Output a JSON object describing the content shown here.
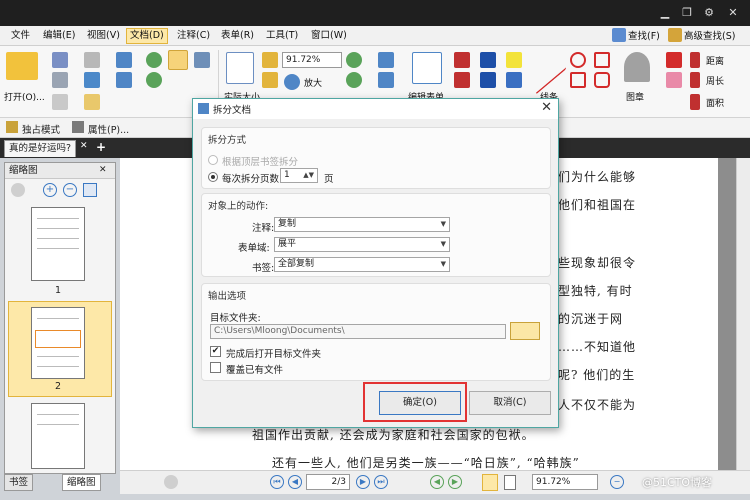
{
  "menu": [
    "文件",
    "编辑(E)",
    "视图(V)",
    "文档(D)",
    "注释(C)",
    "表单(R)",
    "工具(T)",
    "窗口(W)"
  ],
  "menu_active_index": 3,
  "menu_right": {
    "find": "查找(F)",
    "advanced_find": "高级查找(S)"
  },
  "ribbon": {
    "open_label": "打开(O)...",
    "zoom_value": "91.72%",
    "zoom_in_label": "放大",
    "actual_size_label": "实际大小",
    "edit_form_label": "编辑表单",
    "line_label": "线条",
    "stamp_label": "图章",
    "distance_label": "距离",
    "perimeter_label": "周长",
    "area_label": "面积"
  },
  "modebar": {
    "exclusive_mode": "独占模式",
    "properties": "属性(P)..."
  },
  "doc_tab": "真的是好运吗?",
  "left_panel": {
    "title": "缩略图",
    "pages": [
      "1",
      "2"
    ],
    "selected": "2"
  },
  "bottom_tabs": [
    "书签",
    "缩略图"
  ],
  "document_lines": [
    "们为什么能够",
    "他们和祖国在",
    "些现象却很令",
    "型独特, 有时",
    "的沉迷于网",
    "……不知道他",
    "呢? 他们的生",
    "人不仅不能为",
    "祖国作出贡献, 还会成为家庭和社会国家的包袱。",
    "还有一些人, 他们是另类一族——“哈日族”, “哈韩族”"
  ],
  "status": {
    "page_value": "2",
    "page_total": "/3",
    "zoom": "91.72%"
  },
  "dialog": {
    "title": "拆分文档",
    "split_method": {
      "title": "拆分方式",
      "by_bookmark": "根据顶层书签拆分",
      "by_pages": "每次拆分页数",
      "pages_value": "1",
      "pages_unit": "页"
    },
    "actions": {
      "title": "对象上的动作:",
      "annotations_label": "注释:",
      "annotations_value": "复制",
      "forms_label": "表单域:",
      "forms_value": "展平",
      "bookmarks_label": "书签:",
      "bookmarks_value": "全部复制"
    },
    "output": {
      "title": "输出选项",
      "folder_label": "目标文件夹:",
      "folder_value": "C:\\Users\\Mloong\\Documents\\",
      "open_after": "完成后打开目标文件夹",
      "overwrite": "覆盖已有文件"
    },
    "ok_label": "确定(O)",
    "cancel_label": "取消(C)"
  },
  "watermark": "@51CTO博客",
  "colors": {
    "accent_red": "#e23333",
    "menu_active": "#fde8a8",
    "dialog_border": "#4fa6a2"
  }
}
